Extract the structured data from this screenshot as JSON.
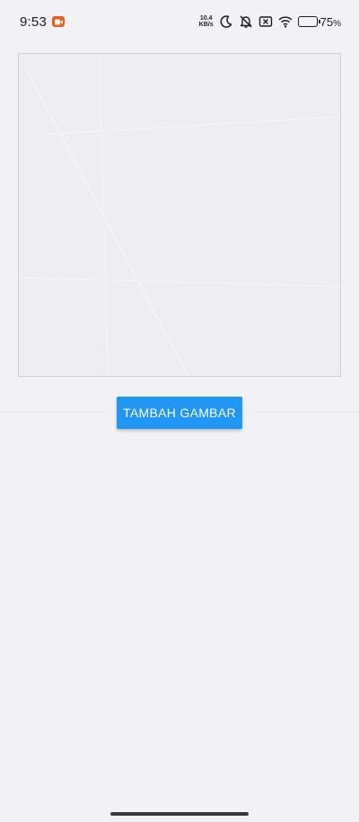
{
  "status_bar": {
    "time": "9:53",
    "network_speed_value": "10.4",
    "network_speed_unit": "KB/s",
    "battery_level": 75,
    "battery_number": "75",
    "battery_unit": "%",
    "icons": [
      "screen-record-icon",
      "moon-icon",
      "vibrate-off-icon",
      "no-sim-icon",
      "wifi-icon",
      "battery-icon"
    ]
  },
  "main": {
    "add_image_button_label": "TAMBAH GAMBAR"
  },
  "colors": {
    "background": "#f2f1f5",
    "button": "#2196f3",
    "button_text": "#ffffff",
    "record_badge": "#f05a1f"
  }
}
